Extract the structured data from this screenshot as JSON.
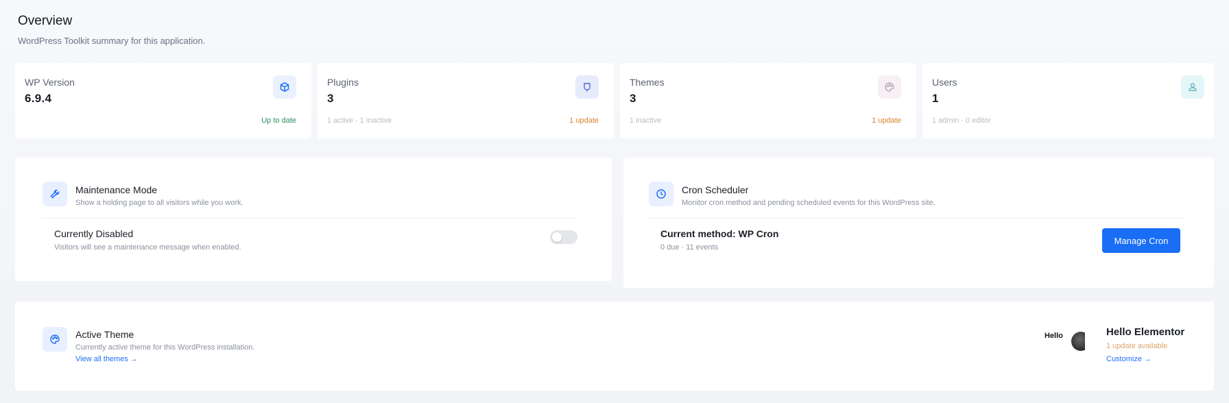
{
  "header": {
    "title": "Overview",
    "subtitle": "WordPress Toolkit summary for this application."
  },
  "stats": [
    {
      "label": "WP Version",
      "value": "6.9.4",
      "foot_left": "",
      "foot_right": "Up to date",
      "foot_right_color": "#2a8f5b",
      "icon": "cube-icon",
      "icon_bg": "#eaf0fe",
      "icon_color": "#1a6ef5"
    },
    {
      "label": "Plugins",
      "value": "3",
      "foot_left": "1 active · 1 inactive",
      "foot_right": "1 update",
      "foot_right_color": "#d9822b",
      "icon": "plugin-icon",
      "icon_bg": "#e6ecfb",
      "icon_color": "#5b6fd6"
    },
    {
      "label": "Themes",
      "value": "3",
      "foot_left": "1 inactive",
      "foot_right": "1 update",
      "foot_right_color": "#d9822b",
      "icon": "palette-icon",
      "icon_bg": "#f7f1f5",
      "icon_color": "#b9a6b4"
    },
    {
      "label": "Users",
      "value": "1",
      "foot_left": "1 admin · 0 editor",
      "foot_right": "",
      "foot_right_color": "#8a909c",
      "icon": "users-icon",
      "icon_bg": "#e4f6f8",
      "icon_color": "#6fb5c0"
    }
  ],
  "maintenance": {
    "title": "Maintenance Mode",
    "description": "Show a holding page to all visitors while you work.",
    "status_title": "Currently Disabled",
    "status_description": "Visitors will see a maintenance message when enabled.",
    "enabled": false
  },
  "cron": {
    "title": "Cron Scheduler",
    "description": "Monitor cron method and pending scheduled events for this WordPress site.",
    "method_label": "Current method: WP Cron",
    "events_summary": "0 due · 11 events",
    "button_label": "Manage Cron"
  },
  "active_theme": {
    "title": "Active Theme",
    "description": "Currently active theme for this WordPress installation.",
    "view_all_label": "View all themes →",
    "theme_name": "Hello Elementor",
    "thumb_text": "Hello",
    "update_label": "1 update available",
    "customize_label": "Customize →"
  },
  "colors": {
    "accent": "#1a6ef5",
    "warning": "#d9822b",
    "success": "#2a8f5b"
  }
}
